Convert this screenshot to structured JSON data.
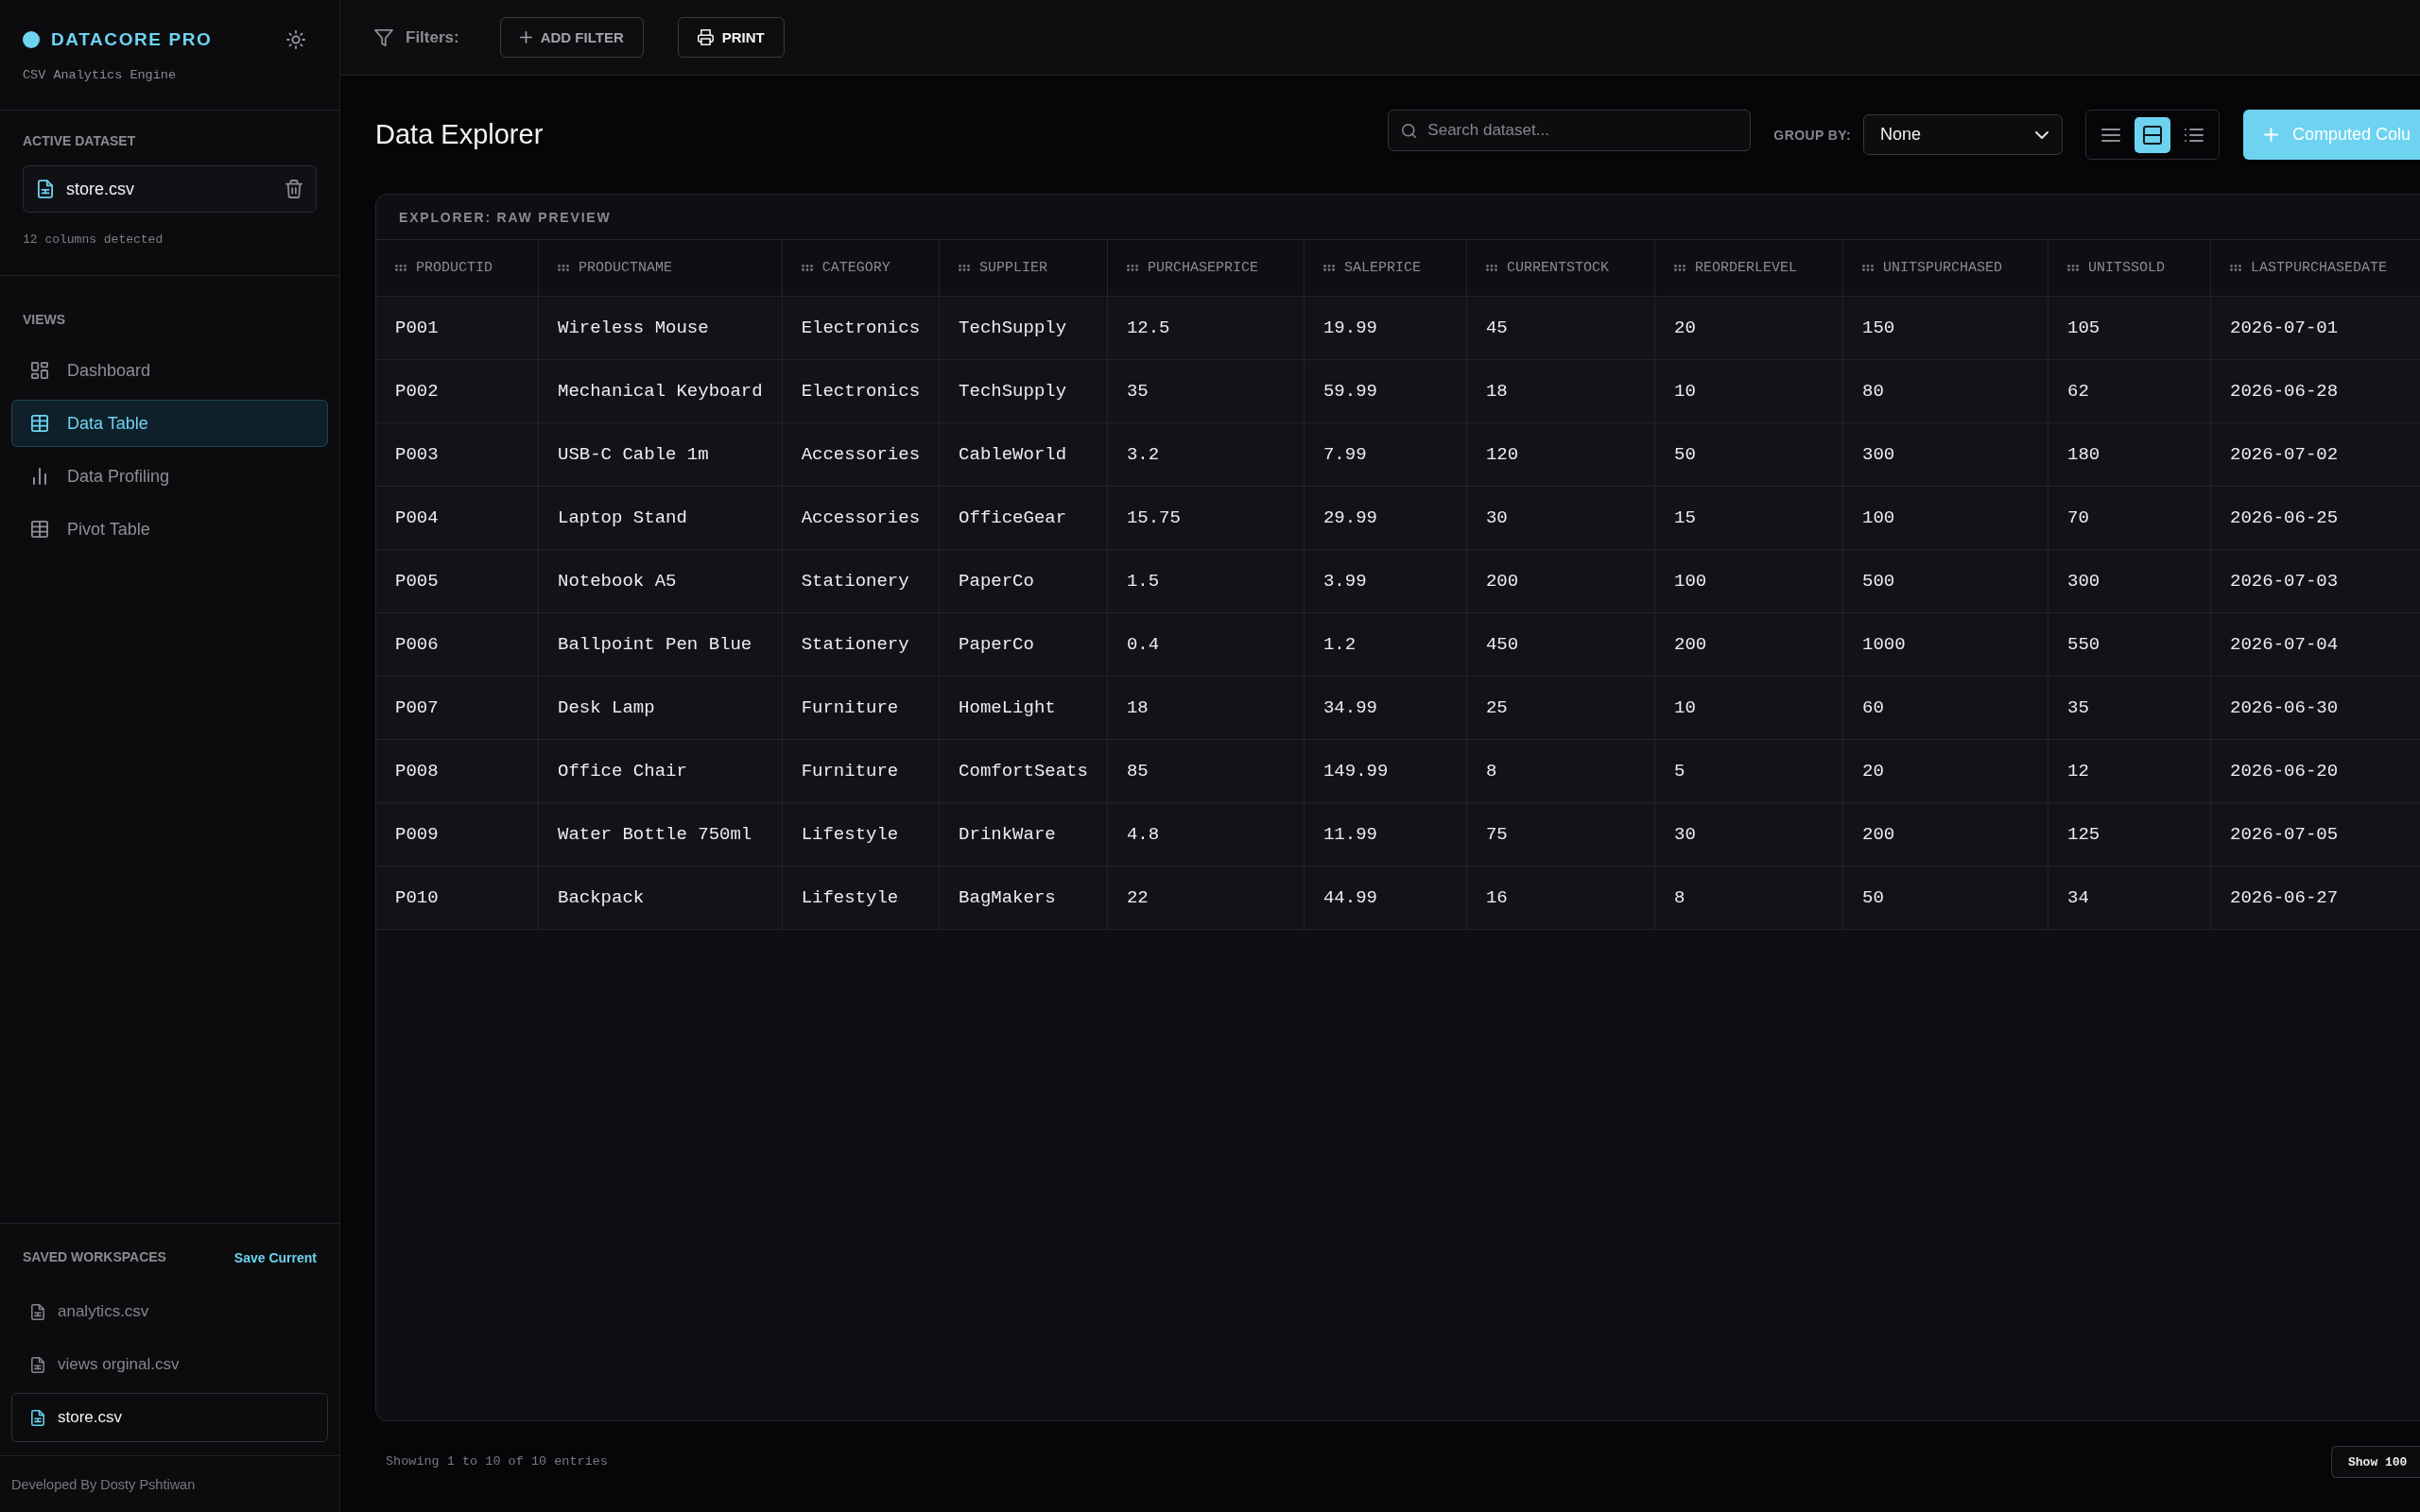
{
  "sidebar": {
    "brand": {
      "title": "DATACORE PRO",
      "subtitle": "CSV Analytics Engine"
    },
    "active_dataset": {
      "heading": "ACTIVE DATASET",
      "file": "store.csv",
      "info": "12 columns detected"
    },
    "views": {
      "heading": "VIEWS",
      "items": [
        {
          "label": "Dashboard",
          "kind": "dashboard",
          "selected": false
        },
        {
          "label": "Data Table",
          "kind": "table",
          "selected": true
        },
        {
          "label": "Data Profiling",
          "kind": "chart",
          "selected": false
        },
        {
          "label": "Pivot Table",
          "kind": "table",
          "selected": false
        }
      ]
    },
    "saved_workspaces": {
      "heading": "SAVED WORKSPACES",
      "action": "Save Current",
      "items": [
        {
          "label": "analytics.csv",
          "selected": false
        },
        {
          "label": "views orginal.csv",
          "selected": false
        },
        {
          "label": "store.csv",
          "selected": true
        }
      ]
    },
    "footer": "Developed By Dosty Pshtiwan"
  },
  "toolbar": {
    "filters_label": "Filters:",
    "buttons": [
      {
        "label": "ADD FILTER",
        "kind": "add"
      },
      {
        "label": "PRINT",
        "kind": "print"
      }
    ]
  },
  "header": {
    "title": "Data Explorer",
    "search": {
      "placeholder": "Search dataset..."
    },
    "group_by": {
      "label": "GROUP BY:",
      "value": "None"
    },
    "view_modes": [
      {
        "kind": "lines",
        "selected": false
      },
      {
        "kind": "split",
        "selected": true
      },
      {
        "kind": "bullets",
        "selected": false
      }
    ],
    "computed_button": "Computed Colu"
  },
  "table": {
    "title": "EXPLORER: RAW PREVIEW",
    "columns": [
      "PRODUCTID",
      "PRODUCTNAME",
      "CATEGORY",
      "SUPPLIER",
      "PURCHASEPRICE",
      "SALEPRICE",
      "CURRENTSTOCK",
      "REORDERLEVEL",
      "UNITSPURCHASED",
      "UNITSSOLD",
      "LASTPURCHASEDATE"
    ],
    "rows": [
      [
        "P001",
        "Wireless Mouse",
        "Electronics",
        "TechSupply",
        "12.5",
        "19.99",
        "45",
        "20",
        "150",
        "105",
        "2026-07-01"
      ],
      [
        "P002",
        "Mechanical Keyboard",
        "Electronics",
        "TechSupply",
        "35",
        "59.99",
        "18",
        "10",
        "80",
        "62",
        "2026-06-28"
      ],
      [
        "P003",
        "USB-C Cable 1m",
        "Accessories",
        "CableWorld",
        "3.2",
        "7.99",
        "120",
        "50",
        "300",
        "180",
        "2026-07-02"
      ],
      [
        "P004",
        "Laptop Stand",
        "Accessories",
        "OfficeGear",
        "15.75",
        "29.99",
        "30",
        "15",
        "100",
        "70",
        "2026-06-25"
      ],
      [
        "P005",
        "Notebook A5",
        "Stationery",
        "PaperCo",
        "1.5",
        "3.99",
        "200",
        "100",
        "500",
        "300",
        "2026-07-03"
      ],
      [
        "P006",
        "Ballpoint Pen Blue",
        "Stationery",
        "PaperCo",
        "0.4",
        "1.2",
        "450",
        "200",
        "1000",
        "550",
        "2026-07-04"
      ],
      [
        "P007",
        "Desk Lamp",
        "Furniture",
        "HomeLight",
        "18",
        "34.99",
        "25",
        "10",
        "60",
        "35",
        "2026-06-30"
      ],
      [
        "P008",
        "Office Chair",
        "Furniture",
        "ComfortSeats",
        "85",
        "149.99",
        "8",
        "5",
        "20",
        "12",
        "2026-06-20"
      ],
      [
        "P009",
        "Water Bottle 750ml",
        "Lifestyle",
        "DrinkWare",
        "4.8",
        "11.99",
        "75",
        "30",
        "200",
        "125",
        "2026-07-05"
      ],
      [
        "P010",
        "Backpack",
        "Lifestyle",
        "BagMakers",
        "22",
        "44.99",
        "16",
        "8",
        "50",
        "34",
        "2026-06-27"
      ]
    ]
  },
  "footer": {
    "summary": "Showing 1 to 10 of 10 entries",
    "page_size": "Show 100"
  }
}
